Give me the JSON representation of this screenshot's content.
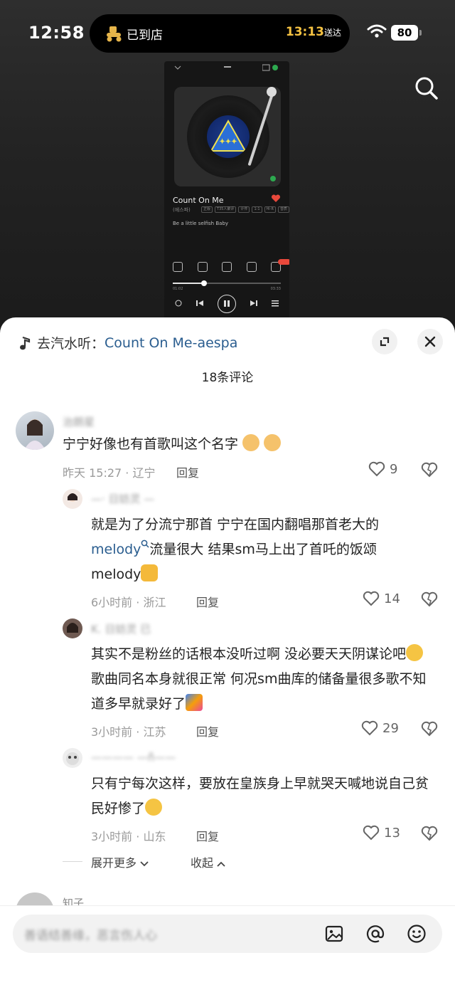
{
  "status_bar": {
    "time": "12:58",
    "island_left": "已到店",
    "island_time": "13:13",
    "island_suffix": "送达",
    "battery": "80"
  },
  "embedded_player": {
    "song_title": "Count On Me",
    "artist": "(에스파)",
    "tags": [
      "正版",
      "T35人聚评",
      "计件",
      "1:1",
      "Hi-R",
      "音质"
    ],
    "lyric": "Be a little selfish Baby",
    "time_elapsed": "01:02",
    "time_total": "03:33",
    "progress_fraction": 0.29
  },
  "sheet": {
    "music_prefix": "去汽水听：",
    "music_song": "Count On Me-aespa",
    "comments_count_title": "18条评论"
  },
  "comments": [
    {
      "username": "治朗星",
      "text": "宁宁好像也有首歌叫这个名字",
      "emoji": [
        "dog-face",
        "dog-face"
      ],
      "time": "昨天 15:27 · 辽宁",
      "reply": "回复",
      "likes": "9"
    },
    {
      "username": "—· 日妨灵 —",
      "text_1": "就是为了分流宁那首 宁宁在国内翻唱那首老大的",
      "keyword": "melody",
      "text_2": "流量很大 结果sm马上出了首吒的饭颂",
      "text_3": "melody",
      "emoji": [
        "thumbs-up"
      ],
      "time": "6小时前 · 浙江",
      "reply": "回复",
      "likes": "14"
    },
    {
      "username": "K. 日妨灵 已",
      "text": "其实不是粉丝的话根本没听过啊 没必要天天阴谋论吧",
      "text_2": " 歌曲同名本身就很正常 何况sm曲库的储备量很多歌不知道多早就录好了",
      "emoji": [
        "dizzy-face",
        "kite"
      ],
      "time": "3小时前 · 江苏",
      "reply": "回复",
      "likes": "29"
    },
    {
      "username": "———— —ñ——",
      "text": "只有宁每次这样，要放在皇族身上早就哭天喊地说自己贫民好惨了",
      "emoji": [
        "sad-face"
      ],
      "time": "3小时前 · 山东",
      "reply": "回复",
      "likes": "13"
    }
  ],
  "thread_controls": {
    "show_more": "展开更多",
    "collapse": "收起"
  },
  "next_comment_username": "知子",
  "input_bar": {
    "placeholder": "善语结善缘，恶言伤人心"
  }
}
